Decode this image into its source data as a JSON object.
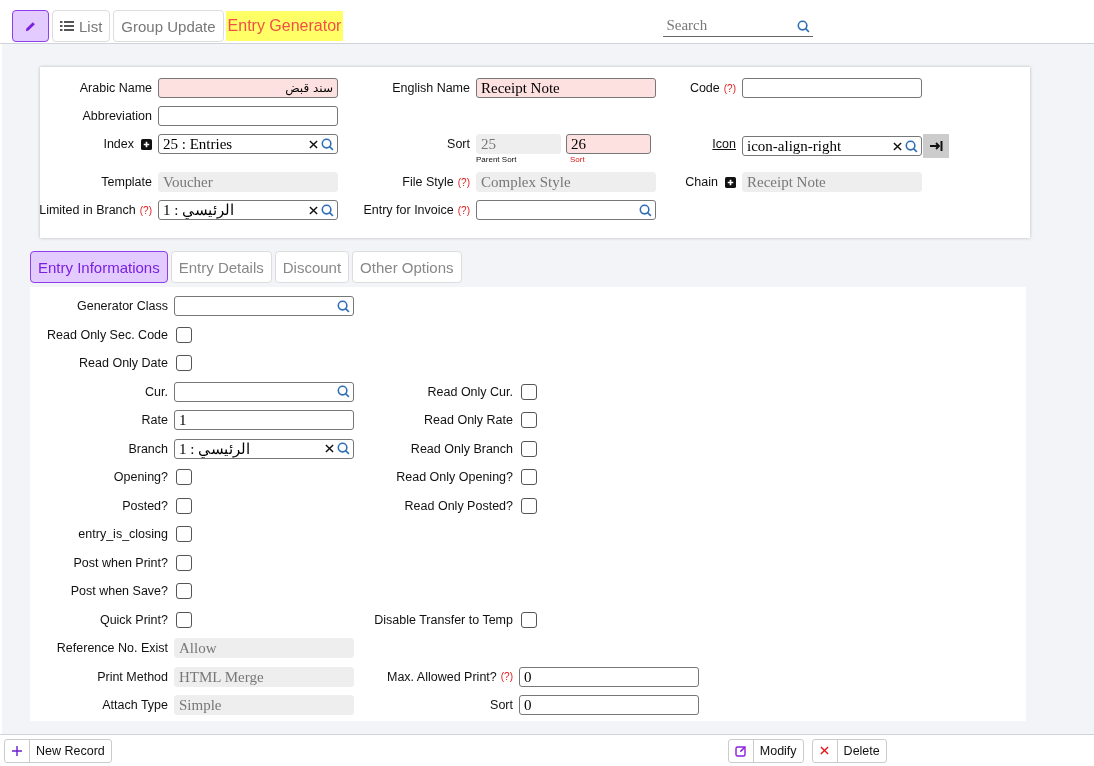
{
  "toolbar": {
    "buttons": [
      {
        "kind": "edit",
        "selected": true
      },
      {
        "kind": "list",
        "label": "List",
        "selected": false
      },
      {
        "kind": "text",
        "label": "Group Update",
        "selected": false
      }
    ],
    "title": "Entry Generator",
    "search": {
      "placeholder": "Search"
    }
  },
  "header": {
    "rows": [
      [
        {
          "label": "Arabic Name",
          "kind": "text",
          "value": "سند قبض",
          "required": true,
          "rtl": true
        },
        {
          "label": "English Name",
          "kind": "text",
          "value": "Receipt Note",
          "required": true
        },
        {
          "label": "Code",
          "help": "(?)",
          "kind": "text"
        }
      ],
      [
        {
          "label": "Abbreviation",
          "kind": "text"
        }
      ],
      [
        {
          "label": "Index",
          "add_button": true,
          "kind": "lookup",
          "clear": true,
          "value": "25 : Entries"
        },
        {
          "label": "Sort",
          "kind": "pair",
          "first": {
            "value": "25",
            "caption": "Parent Sort"
          },
          "second": {
            "value": "26",
            "caption": "Sort",
            "required": true
          }
        },
        {
          "label": "Icon",
          "link": true,
          "kind": "lookup",
          "clear": true,
          "value": "icon-align-right",
          "preview": true
        }
      ],
      [
        {
          "label": "Template",
          "kind": "readonly",
          "value": "Voucher"
        },
        {
          "label": "File Style",
          "help": "(?)",
          "kind": "readonly",
          "value": "Complex Style"
        },
        {
          "label": "Chain",
          "add_button": true,
          "kind": "readonly",
          "value": "Receipt Note"
        }
      ],
      [
        {
          "label": "Limited in Branch",
          "help": "(?)",
          "kind": "lookup",
          "clear": true,
          "value": "1 : الرئيسي"
        },
        {
          "label": "Entry for Invoice",
          "help": "(?)",
          "kind": "lookup",
          "clear": false
        }
      ]
    ]
  },
  "tabs": [
    {
      "label": "Entry Informations",
      "selected": true
    },
    {
      "label": "Entry Details",
      "selected": false
    },
    {
      "label": "Discount",
      "selected": false
    },
    {
      "label": "Other Options",
      "selected": false
    }
  ],
  "panel": {
    "rows": [
      {
        "left": {
          "label": "Generator Class",
          "kind": "lookup",
          "clear": false
        }
      },
      {
        "left": {
          "label": "Read Only Sec. Code",
          "kind": "checkbox",
          "checked": false
        }
      },
      {
        "left": {
          "label": "Read Only Date",
          "kind": "checkbox",
          "checked": false
        }
      },
      {
        "left": {
          "label": "Cur.",
          "kind": "lookup",
          "clear": false
        },
        "right": {
          "label": "Read Only Cur.",
          "kind": "checkbox",
          "checked": false
        }
      },
      {
        "left": {
          "label": "Rate",
          "kind": "text",
          "value": "1"
        },
        "right": {
          "label": "Read Only Rate",
          "kind": "checkbox",
          "checked": false
        }
      },
      {
        "left": {
          "label": "Branch",
          "kind": "lookup",
          "clear": true,
          "value": "1 : الرئيسي"
        },
        "right": {
          "label": "Read Only Branch",
          "kind": "checkbox",
          "checked": false
        }
      },
      {
        "left": {
          "label": "Opening?",
          "kind": "checkbox",
          "checked": false
        },
        "right": {
          "label": "Read Only Opening?",
          "kind": "checkbox",
          "checked": false
        }
      },
      {
        "left": {
          "label": "Posted?",
          "kind": "checkbox",
          "checked": false
        },
        "right": {
          "label": "Read Only Posted?",
          "kind": "checkbox",
          "checked": false
        }
      },
      {
        "left": {
          "label": "entry_is_closing",
          "kind": "checkbox",
          "checked": false
        }
      },
      {
        "left": {
          "label": "Post when Print?",
          "kind": "checkbox",
          "checked": false
        }
      },
      {
        "left": {
          "label": "Post when Save?",
          "kind": "checkbox",
          "checked": false
        }
      },
      {
        "left": {
          "label": "Quick Print?",
          "kind": "checkbox",
          "checked": false
        },
        "right": {
          "label": "Disable Transfer to Temp",
          "kind": "checkbox",
          "checked": false
        }
      },
      {
        "left": {
          "label": "Reference No. Exist",
          "kind": "readonly",
          "value": "Allow"
        }
      },
      {
        "left": {
          "label": "Print Method",
          "kind": "readonly",
          "value": "HTML Merge"
        },
        "right": {
          "label": "Max. Allowed Print?",
          "help": "(?)",
          "kind": "text",
          "value": "0"
        }
      },
      {
        "left": {
          "label": "Attach Type",
          "kind": "readonly",
          "value": "Simple"
        },
        "right": {
          "label": "Sort",
          "kind": "text",
          "value": "0"
        }
      }
    ]
  },
  "footer": {
    "buttons": [
      {
        "kind": "add",
        "label": "New Record"
      },
      {
        "kind": "modify",
        "label": "Modify"
      },
      {
        "kind": "delete",
        "label": "Delete"
      }
    ]
  }
}
